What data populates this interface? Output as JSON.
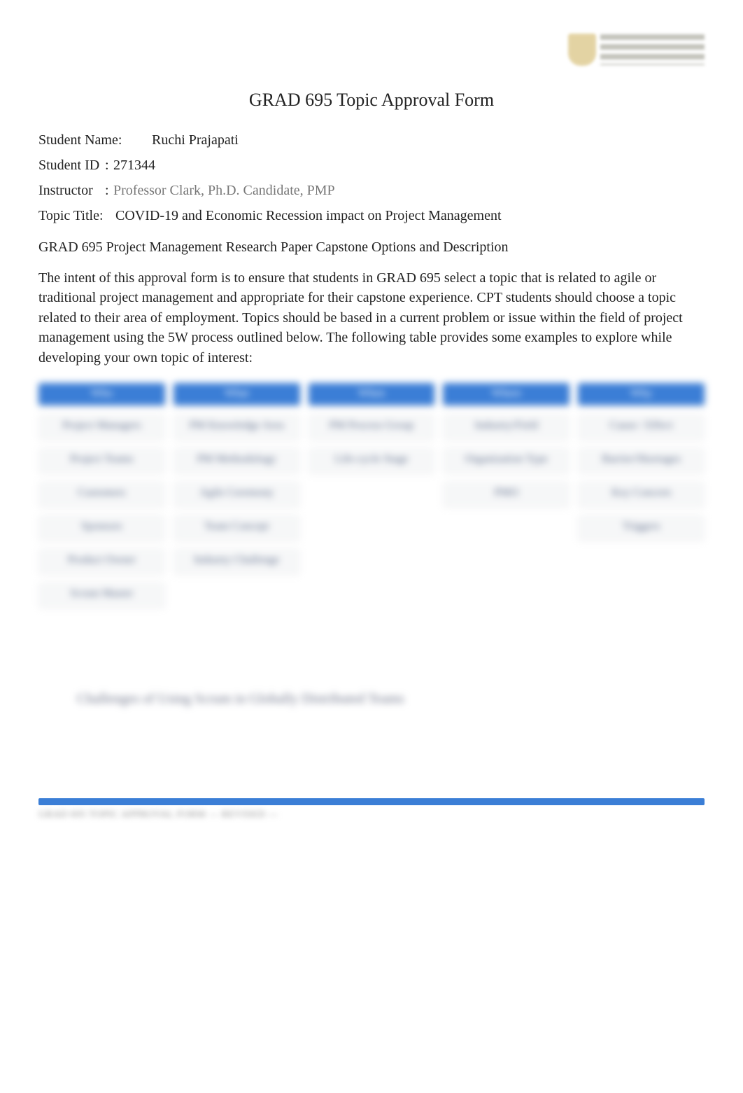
{
  "logo": {
    "institution": "University"
  },
  "title": "GRAD 695 Topic Approval Form",
  "fields": {
    "student_name_label": "Student Name:",
    "student_name_value": "Ruchi Prajapati",
    "student_id_label": "Student ID",
    "student_id_value": "271344",
    "instructor_label": "Instructor",
    "instructor_value": "Professor Clark, Ph.D. Candidate, PMP",
    "topic_title_label": "Topic Title:",
    "topic_title_value": "COVID-19 and Economic Recession impact on Project Management"
  },
  "section_heading": "GRAD 695 Project Management Research Paper Capstone Options and Description",
  "intro_paragraph": "The intent of this approval form is to ensure that students in GRAD 695 select a topic that is related to agile or traditional project management and appropriate for their capstone experience. CPT students should choose a topic related to their area of employment. Topics should be based in a current problem or issue within the field of project management using the 5W process outlined below. The following table provides some examples to explore while developing your own topic of interest:",
  "table": {
    "headers": [
      "Who",
      "What",
      "When",
      "Where",
      "Why"
    ],
    "col1": [
      "Project Managers",
      "Project Teams",
      "Customers",
      "Sponsors",
      "Product Owner",
      "Scrum Master"
    ],
    "col2": [
      "PM Knowledge Area",
      "PM Methodology",
      "Agile Ceremony",
      "Team Concept",
      "Industry Challenge"
    ],
    "col3": [
      "PM Process Group",
      "Life-cycle Stage"
    ],
    "col4": [
      "Industry/Field",
      "Organization Type",
      "PMO"
    ],
    "col5": [
      "Cause / Effect",
      "Barrier/Shortages",
      "Key Concern",
      "Triggers"
    ]
  },
  "example_text": "Challenges of Using Scrum in Globally Distributed Teams",
  "footer_text": "GRAD 695 TOPIC APPROVAL FORM — REVISED —"
}
